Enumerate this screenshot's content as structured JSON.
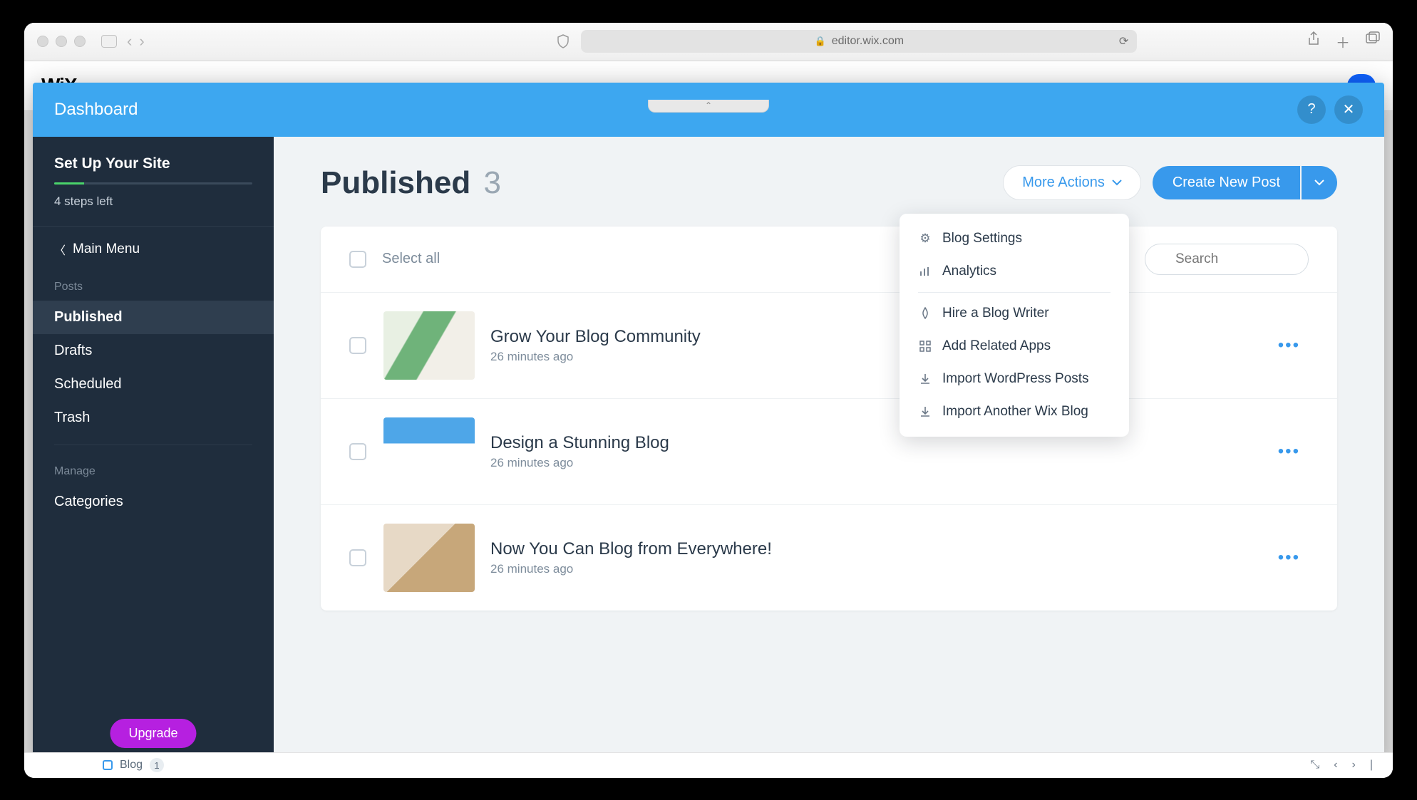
{
  "browser": {
    "url": "editor.wix.com"
  },
  "dashboard": {
    "header_title": "Dashboard"
  },
  "sidebar": {
    "setup": {
      "title": "Set Up Your Site",
      "steps_left": "4 steps left"
    },
    "main_menu_label": "Main Menu",
    "section_posts_label": "Posts",
    "items": {
      "published": "Published",
      "drafts": "Drafts",
      "scheduled": "Scheduled",
      "trash": "Trash"
    },
    "section_manage_label": "Manage",
    "categories": "Categories",
    "upgrade_label": "Upgrade"
  },
  "main": {
    "title": "Published",
    "count": "3",
    "more_actions_label": "More Actions",
    "create_post_label": "Create New Post",
    "select_all_label": "Select all",
    "search_placeholder": "Search",
    "posts": [
      {
        "title": "Grow Your Blog Community",
        "time": "26 minutes ago"
      },
      {
        "title": "Design a Stunning Blog",
        "time": "26 minutes ago"
      },
      {
        "title": "Now You Can Blog from Everywhere!",
        "time": "26 minutes ago"
      }
    ]
  },
  "dropdown": {
    "blog_settings": "Blog Settings",
    "analytics": "Analytics",
    "hire_writer": "Hire a Blog Writer",
    "related_apps": "Add Related Apps",
    "import_wp": "Import WordPress Posts",
    "import_wix": "Import Another Wix Blog"
  },
  "bg": {
    "blog_label": "Blog",
    "badge": "1"
  }
}
